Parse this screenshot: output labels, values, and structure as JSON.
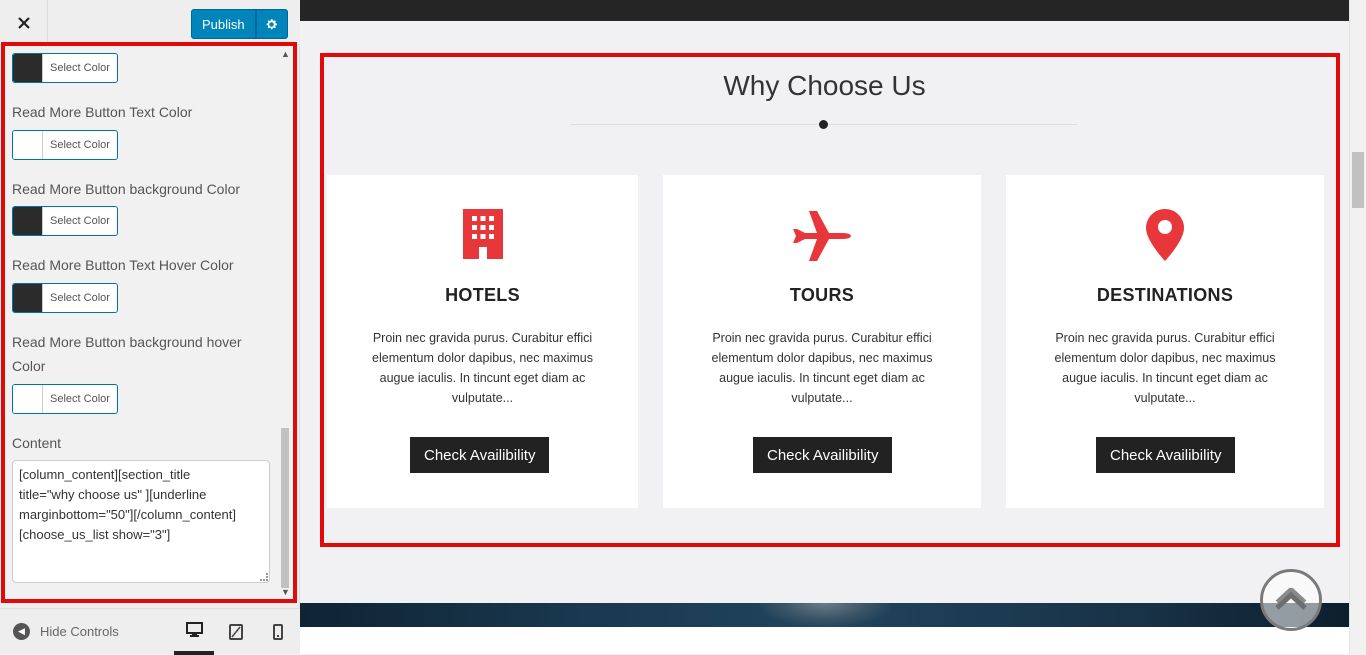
{
  "header": {
    "close_icon": "close-icon",
    "publish_label": "Publish",
    "settings_icon": "gear-icon"
  },
  "sidebar": {
    "controls": [
      {
        "label": "",
        "button": "Select Color",
        "swatch": "#2b2b2b"
      },
      {
        "label": "Read More Button Text Color",
        "button": "Select Color",
        "swatch": "#ffffff"
      },
      {
        "label": "Read More Button background Color",
        "button": "Select Color",
        "swatch": "#2b2b2b"
      },
      {
        "label": "Read More Button Text Hover Color",
        "button": "Select Color",
        "swatch": "#2b2b2b"
      },
      {
        "label": "Read More Button background hover Color",
        "button": "Select Color",
        "swatch": "#ffffff"
      }
    ],
    "content_label": "Content",
    "content_value": "[column_content][section_title\ntitle=\"why choose us\" ][underline\nmarginbottom=\"50\"][/column_content]\n[choose_us_list show=\"3\"]"
  },
  "footer": {
    "hide_controls": "Hide Controls",
    "devices": [
      "desktop-icon",
      "tablet-icon",
      "mobile-icon"
    ],
    "active_device": "desktop"
  },
  "preview": {
    "section_title": "Why Choose Us",
    "cards": [
      {
        "icon": "building-icon",
        "title": "HOTELS",
        "text": "Proin nec gravida purus. Curabitur effici elementum dolor dapibus, nec maximus augue iaculis. In tincunt eget diam ac vulputate...",
        "button": "Check Availibility"
      },
      {
        "icon": "airplane-icon",
        "title": "TOURS",
        "text": "Proin nec gravida purus. Curabitur effici elementum dolor dapibus, nec maximus augue iaculis. In tincunt eget diam ac vulputate...",
        "button": "Check Availibility"
      },
      {
        "icon": "map-pin-icon",
        "title": "DESTINATIONS",
        "text": "Proin nec gravida purus. Curabitur effici elementum dolor dapibus, nec maximus augue iaculis. In tincunt eget diam ac vulputate...",
        "button": "Check Availibility"
      }
    ],
    "icon_color": "#e8373b",
    "highlight_color": "#e10a0a",
    "accent_color": "#0085ba"
  }
}
